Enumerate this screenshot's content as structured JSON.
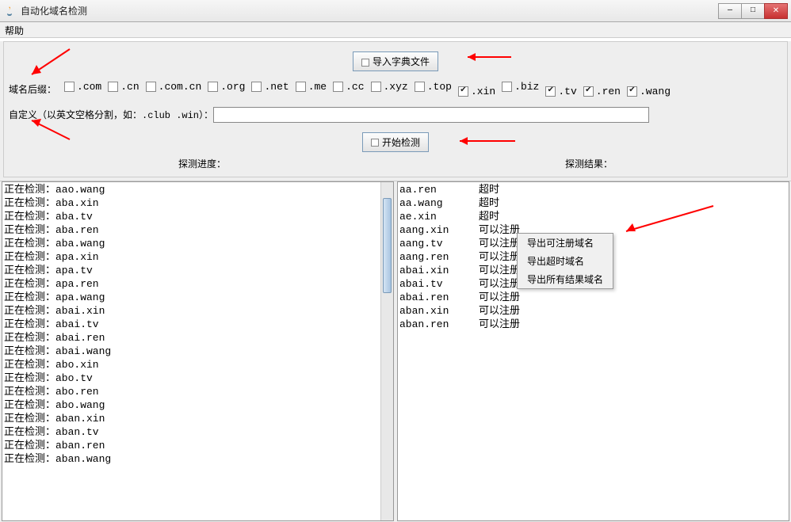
{
  "window": {
    "title": "自动化域名检测",
    "minimize_icon": "—",
    "maximize_icon": "□",
    "close_icon": "✕"
  },
  "menubar": {
    "help": "帮助"
  },
  "import_button": "导入字典文件",
  "suffix": {
    "label": "域名后缀：",
    "items": [
      {
        "label": ".com",
        "checked": false
      },
      {
        "label": ".cn",
        "checked": false
      },
      {
        "label": ".com.cn",
        "checked": false
      },
      {
        "label": ".org",
        "checked": false
      },
      {
        "label": ".net",
        "checked": false
      },
      {
        "label": ".me",
        "checked": false
      },
      {
        "label": ".cc",
        "checked": false
      },
      {
        "label": ".xyz",
        "checked": false
      },
      {
        "label": ".top",
        "checked": false
      },
      {
        "label": ".xin",
        "checked": true
      },
      {
        "label": ".biz",
        "checked": false
      },
      {
        "label": ".tv",
        "checked": true
      },
      {
        "label": ".ren",
        "checked": true
      },
      {
        "label": ".wang",
        "checked": true
      }
    ]
  },
  "custom": {
    "label": "自定义（以英文空格分割，如：.club .win）：",
    "value": ""
  },
  "start_button": "开始检测",
  "headers": {
    "progress": "探测进度：",
    "results": "探测结果："
  },
  "progress_prefix": "正在检测：",
  "progress_list": [
    "aao.wang",
    "aba.xin",
    "aba.tv",
    "aba.ren",
    "aba.wang",
    "apa.xin",
    "apa.tv",
    "apa.ren",
    "apa.wang",
    "abai.xin",
    "abai.tv",
    "abai.ren",
    "abai.wang",
    "abo.xin",
    "abo.tv",
    "abo.ren",
    "abo.wang",
    "aban.xin",
    "aban.tv",
    "aban.ren",
    "aban.wang"
  ],
  "results_list": [
    {
      "domain": "aa.ren",
      "status": "超时"
    },
    {
      "domain": "aa.wang",
      "status": "超时"
    },
    {
      "domain": "ae.xin",
      "status": "超时"
    },
    {
      "domain": "aang.xin",
      "status": "可以注册"
    },
    {
      "domain": "aang.tv",
      "status": "可以注册"
    },
    {
      "domain": "aang.ren",
      "status": "可以注册"
    },
    {
      "domain": "abai.xin",
      "status": "可以注册"
    },
    {
      "domain": "abai.tv",
      "status": "可以注册"
    },
    {
      "domain": "abai.ren",
      "status": "可以注册"
    },
    {
      "domain": "aban.xin",
      "status": "可以注册"
    },
    {
      "domain": "aban.ren",
      "status": "可以注册"
    }
  ],
  "context_menu": [
    "导出可注册域名",
    "导出超时域名",
    "导出所有结果域名"
  ]
}
